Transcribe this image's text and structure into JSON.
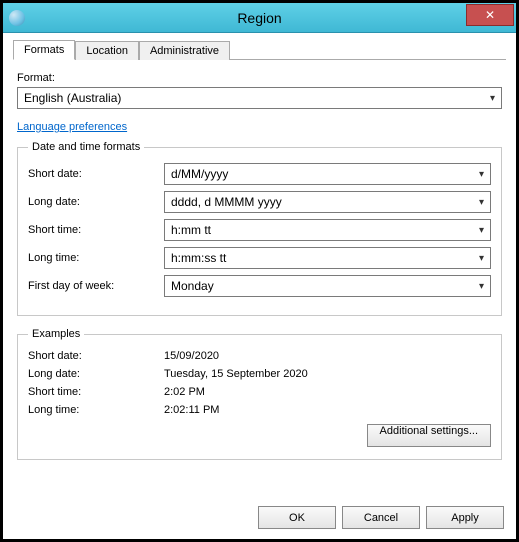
{
  "window": {
    "title": "Region",
    "close_symbol": "✕"
  },
  "tabs": {
    "formats": "Formats",
    "location": "Location",
    "administrative": "Administrative"
  },
  "format": {
    "label": "Format:",
    "value": "English (Australia)"
  },
  "link": {
    "language_preferences": "Language preferences"
  },
  "dtf": {
    "legend": "Date and time formats",
    "short_date_label": "Short date:",
    "short_date_value": "d/MM/yyyy",
    "long_date_label": "Long date:",
    "long_date_value": "dddd, d MMMM yyyy",
    "short_time_label": "Short time:",
    "short_time_value": "h:mm tt",
    "long_time_label": "Long time:",
    "long_time_value": "h:mm:ss tt",
    "first_day_label": "First day of week:",
    "first_day_value": "Monday"
  },
  "examples": {
    "legend": "Examples",
    "short_date_label": "Short date:",
    "short_date_value": "15/09/2020",
    "long_date_label": "Long date:",
    "long_date_value": "Tuesday, 15 September 2020",
    "short_time_label": "Short time:",
    "short_time_value": "2:02 PM",
    "long_time_label": "Long time:",
    "long_time_value": "2:02:11 PM"
  },
  "buttons": {
    "additional": "Additional settings...",
    "ok": "OK",
    "cancel": "Cancel",
    "apply": "Apply"
  }
}
